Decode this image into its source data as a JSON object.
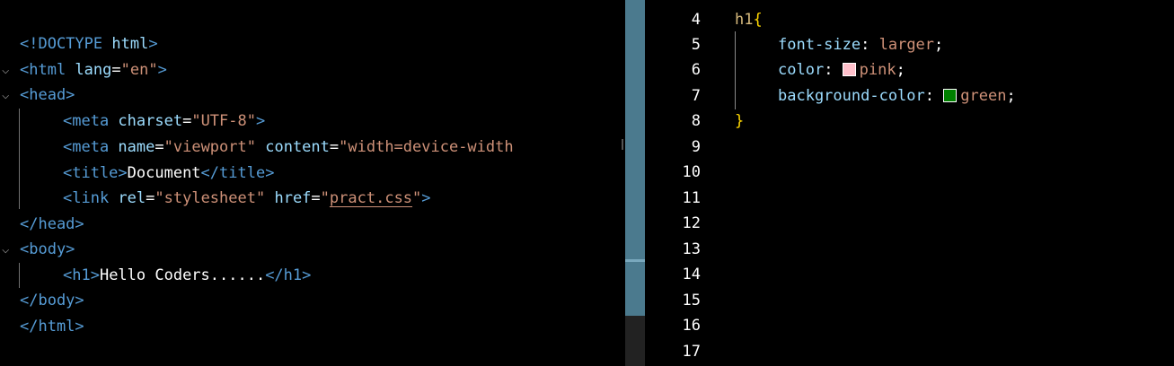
{
  "html_editor": {
    "lines": [
      {
        "parts": [
          {
            "t": "<!DOCTYPE ",
            "c": "tag"
          },
          {
            "t": "html",
            "c": "attr"
          },
          {
            "t": ">",
            "c": "tag"
          }
        ]
      },
      {
        "parts": [
          {
            "t": "<html ",
            "c": "tag"
          },
          {
            "t": "lang",
            "c": "attr"
          },
          {
            "t": "=",
            "c": "txt"
          },
          {
            "t": "\"en\"",
            "c": "str"
          },
          {
            "t": ">",
            "c": "tag"
          }
        ]
      },
      {
        "parts": [
          {
            "t": "<head>",
            "c": "tag"
          }
        ]
      },
      {
        "parts": [
          {
            "t": "<meta ",
            "c": "tag"
          },
          {
            "t": "charset",
            "c": "attr"
          },
          {
            "t": "=",
            "c": "txt"
          },
          {
            "t": "\"UTF-8\"",
            "c": "str"
          },
          {
            "t": ">",
            "c": "tag"
          }
        ]
      },
      {
        "parts": [
          {
            "t": "<meta ",
            "c": "tag"
          },
          {
            "t": "name",
            "c": "attr"
          },
          {
            "t": "=",
            "c": "txt"
          },
          {
            "t": "\"viewport\"",
            "c": "str"
          },
          {
            "t": " ",
            "c": "txt"
          },
          {
            "t": "content",
            "c": "attr"
          },
          {
            "t": "=",
            "c": "txt"
          },
          {
            "t": "\"width=device-width",
            "c": "str"
          }
        ]
      },
      {
        "parts": [
          {
            "t": "<title>",
            "c": "tag"
          },
          {
            "t": "Document",
            "c": "txt"
          },
          {
            "t": "</title>",
            "c": "tag"
          }
        ]
      },
      {
        "parts": [
          {
            "t": "<link ",
            "c": "tag"
          },
          {
            "t": "rel",
            "c": "attr"
          },
          {
            "t": "=",
            "c": "txt"
          },
          {
            "t": "\"stylesheet\"",
            "c": "str"
          },
          {
            "t": " ",
            "c": "txt"
          },
          {
            "t": "href",
            "c": "attr"
          },
          {
            "t": "=",
            "c": "txt"
          },
          {
            "t": "\"",
            "c": "str"
          },
          {
            "t": "pract.css",
            "c": "str ulink"
          },
          {
            "t": "\"",
            "c": "str"
          },
          {
            "t": ">",
            "c": "tag"
          }
        ]
      },
      {
        "parts": [
          {
            "t": "</head>",
            "c": "tag"
          }
        ]
      },
      {
        "parts": [
          {
            "t": "<body>",
            "c": "tag"
          }
        ]
      },
      {
        "parts": [
          {
            "t": "<h1>",
            "c": "tag"
          },
          {
            "t": "Hello Coders......",
            "c": "txt"
          },
          {
            "t": "</h1>",
            "c": "tag"
          }
        ]
      },
      {
        "parts": [
          {
            "t": "</body>",
            "c": "tag"
          }
        ]
      },
      {
        "parts": [
          {
            "t": "</html>",
            "c": "tag"
          }
        ]
      }
    ]
  },
  "css_editor": {
    "line_numbers": [
      "4",
      "5",
      "6",
      "7",
      "8",
      "9",
      "10",
      "11",
      "12",
      "13",
      "14",
      "15",
      "16",
      "17"
    ],
    "lines": [
      {
        "parts": [
          {
            "t": "h1",
            "c": "sel"
          },
          {
            "t": "{",
            "c": "brace"
          }
        ]
      },
      {
        "parts": [
          {
            "t": "font-size",
            "c": "prop"
          },
          {
            "t": ": ",
            "c": "punct"
          },
          {
            "t": "larger",
            "c": "val"
          },
          {
            "t": ";",
            "c": "punct"
          }
        ]
      },
      {
        "parts": [
          {
            "t": "color",
            "c": "prop"
          },
          {
            "t": ": ",
            "c": "punct"
          },
          {
            "t": "pink",
            "c": "val"
          },
          {
            "t": ";",
            "c": "punct"
          }
        ]
      },
      {
        "parts": [
          {
            "t": "background-color",
            "c": "prop"
          },
          {
            "t": ": ",
            "c": "punct"
          },
          {
            "t": "green",
            "c": "val"
          },
          {
            "t": ";",
            "c": "punct"
          }
        ]
      },
      {
        "parts": [
          {
            "t": "}",
            "c": "brace"
          }
        ]
      }
    ],
    "swatches": {
      "pink": "#ffc0cb",
      "green": "#008000"
    }
  },
  "icons": {
    "fold": "chevron-down-icon"
  }
}
